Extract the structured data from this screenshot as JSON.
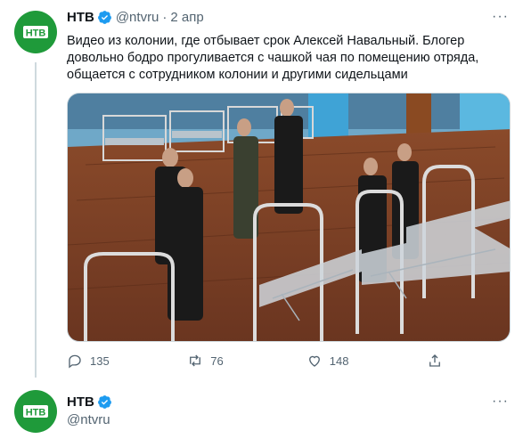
{
  "tweet": {
    "author_name": "НТВ",
    "handle": "@ntvru",
    "separator": "·",
    "date": "2 апр",
    "more_label": "···",
    "text": "Видео из колонии, где отбывает срок Алексей Навальный. Блогер довольно бодро прогуливается с чашкой чая по помещению отряда, общается с сотрудником колонии и другими сидельцами",
    "actions": {
      "replies": "135",
      "retweets": "76",
      "likes": "148"
    }
  },
  "profile": {
    "author_name": "НТВ",
    "handle": "@ntvru",
    "more_label": "···"
  },
  "colors": {
    "brand_green": "#1f9a3a",
    "verified_blue": "#1d9bf0",
    "secondary_text": "#536471"
  }
}
